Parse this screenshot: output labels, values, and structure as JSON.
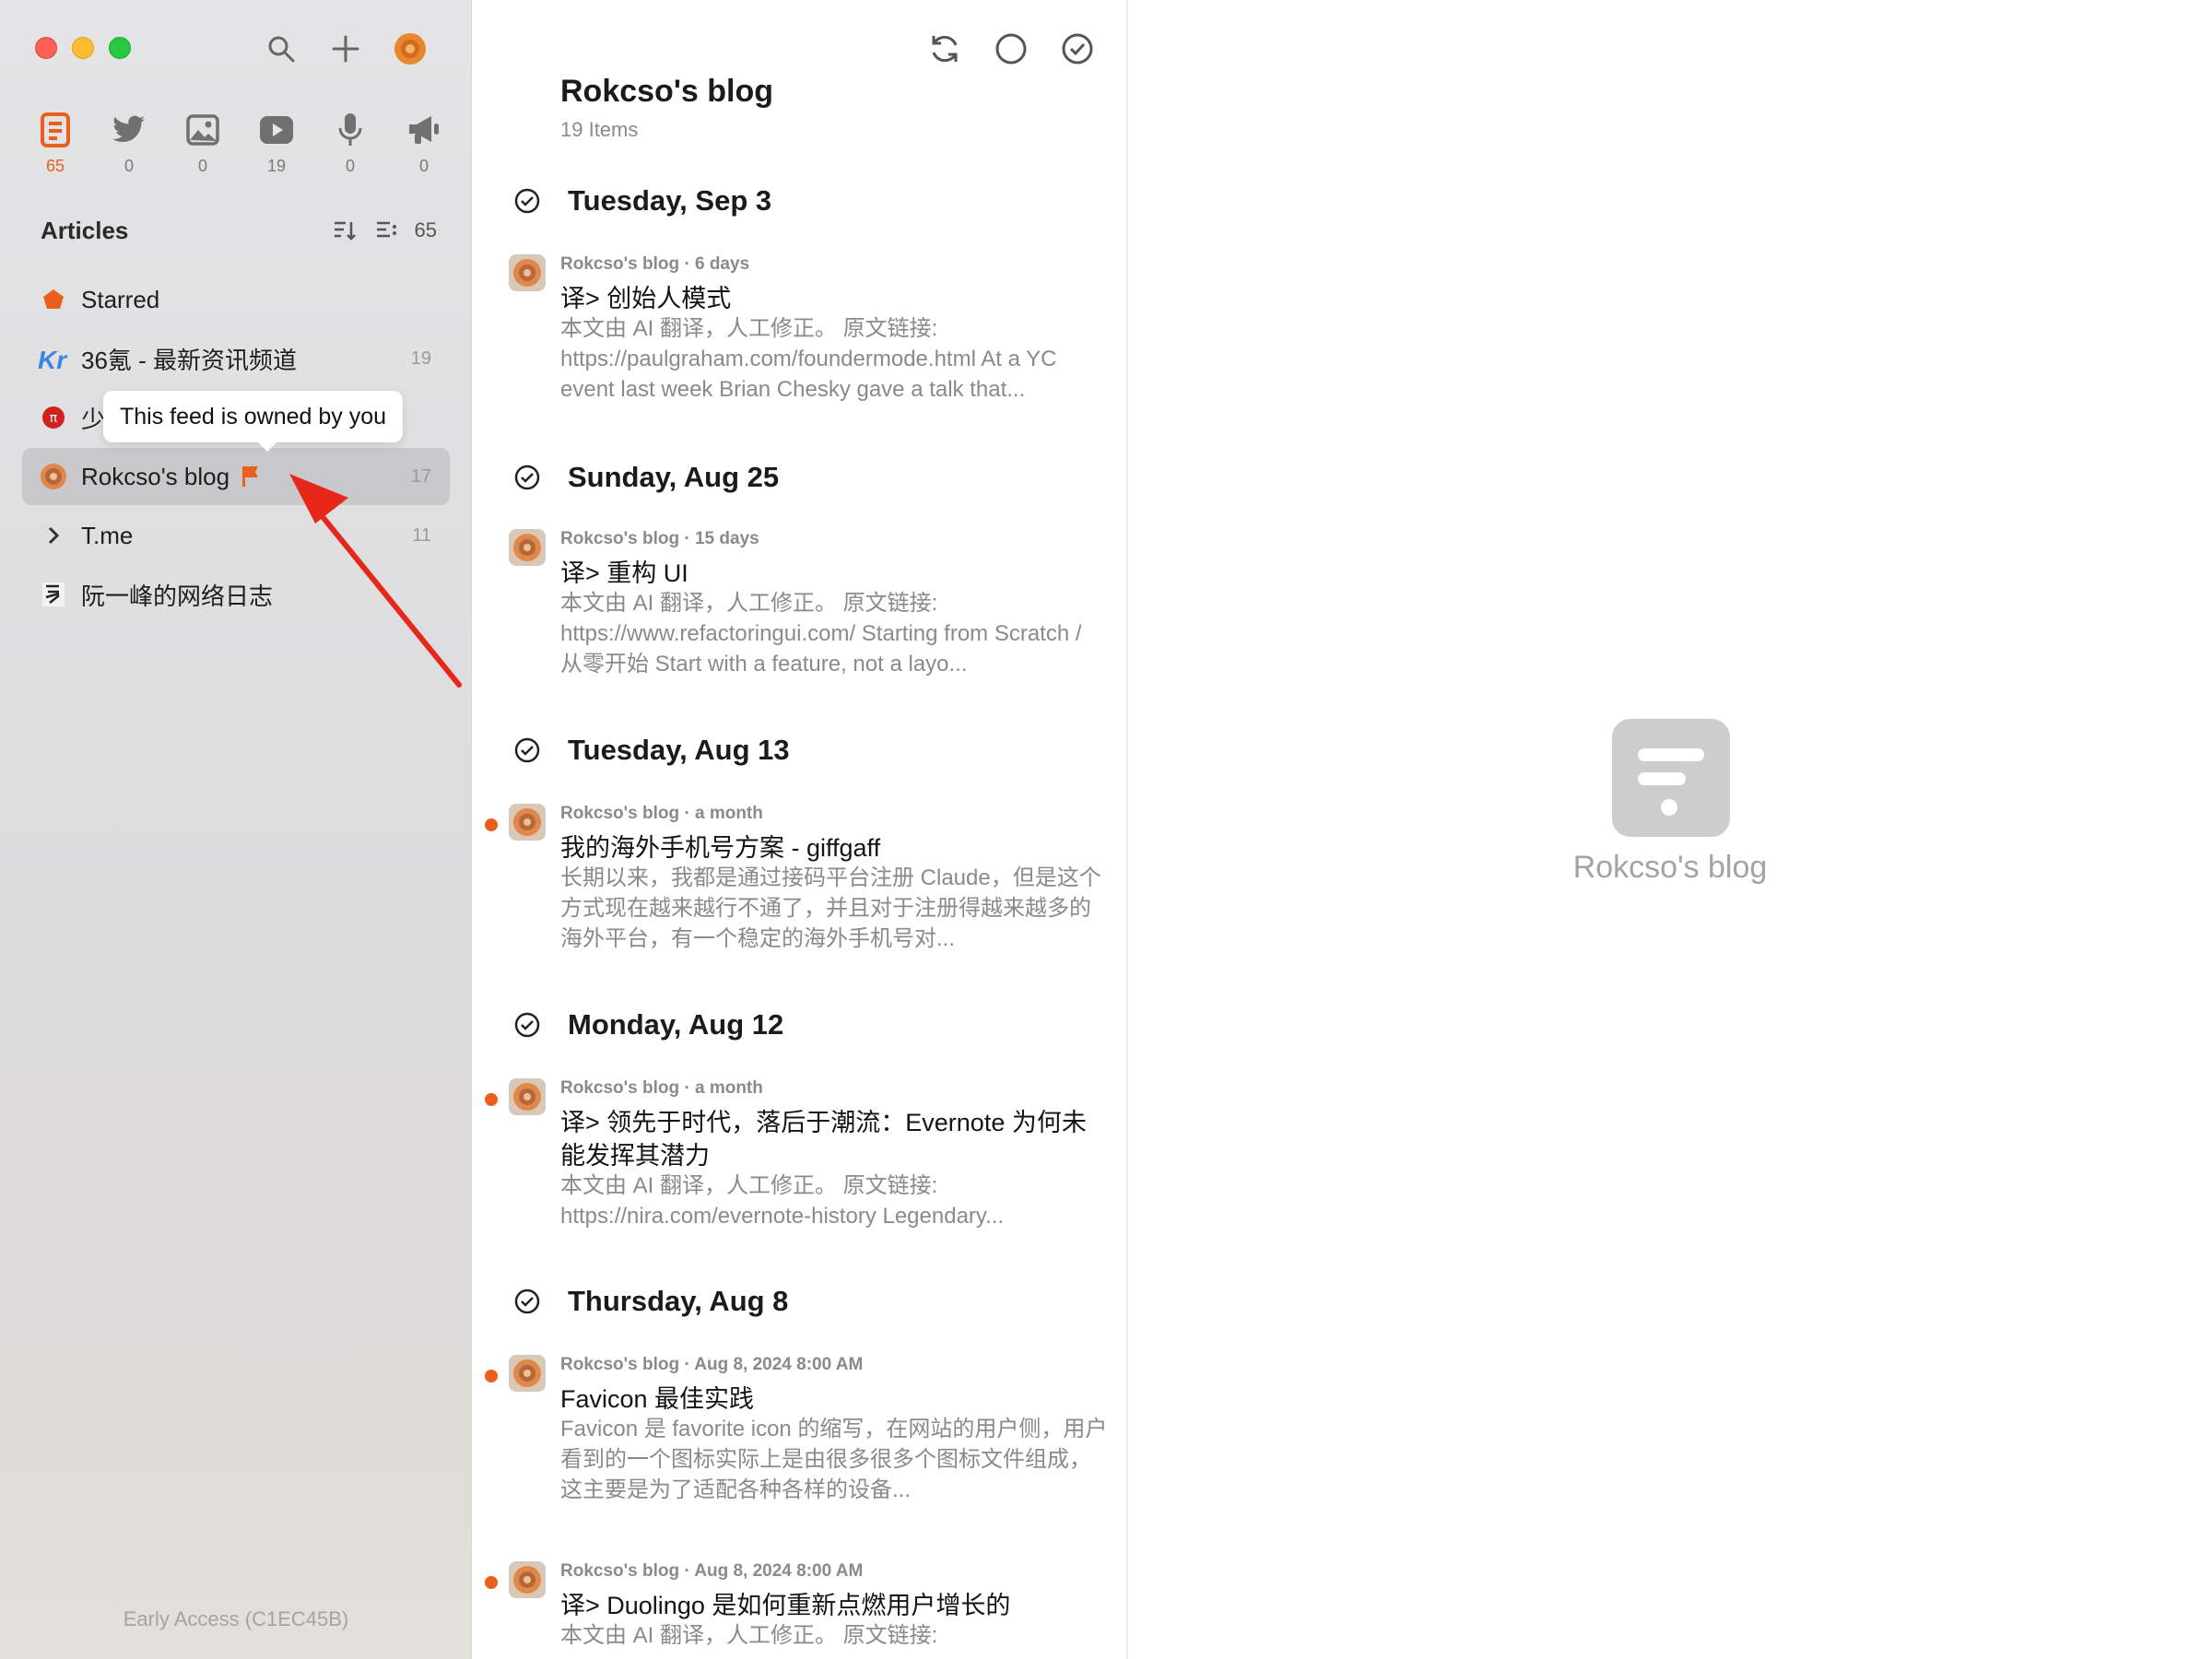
{
  "sidebar": {
    "views": [
      {
        "icon": "article-icon",
        "count": "65",
        "active": true
      },
      {
        "icon": "twitter-icon",
        "count": "0"
      },
      {
        "icon": "image-icon",
        "count": "0"
      },
      {
        "icon": "video-icon",
        "count": "19"
      },
      {
        "icon": "microphone-icon",
        "count": "0"
      },
      {
        "icon": "megaphone-icon",
        "count": "0"
      }
    ],
    "section_title": "Articles",
    "section_count": "65",
    "feeds": [
      {
        "name": "Starred",
        "count": ""
      },
      {
        "name": "36氪 - 最新资讯频道",
        "count": "19"
      },
      {
        "name": "少",
        "count": ""
      },
      {
        "name": "Rokcso's blog",
        "count": "17"
      },
      {
        "name": "T.me",
        "count": "11"
      },
      {
        "name": "阮一峰的网络日志",
        "count": ""
      }
    ],
    "tooltip": "This feed is owned by you",
    "footer": "Early Access (C1EC45B)"
  },
  "list": {
    "title": "Rokcso's blog",
    "subtitle": "19 Items",
    "days": [
      {
        "label": "Tuesday, Sep 3",
        "entries": [
          {
            "meta": "Rokcso's blog · 6 days",
            "title": "译> 创始人模式",
            "summary": "本文由 AI 翻译，人工修正。 原文链接: https://paulgraham.com/foundermode.html At a YC event last week Brian Chesky gave a talk that...",
            "unread": false
          }
        ]
      },
      {
        "label": "Sunday, Aug 25",
        "entries": [
          {
            "meta": "Rokcso's blog · 15 days",
            "title": "译> 重构 UI",
            "summary": "本文由 AI 翻译，人工修正。 原文链接: https://www.refactoringui.com/ Starting from Scratch / 从零开始 Start with a feature, not a layo...",
            "unread": false
          }
        ]
      },
      {
        "label": "Tuesday, Aug 13",
        "entries": [
          {
            "meta": "Rokcso's blog · a month",
            "title": "我的海外手机号方案 - giffgaff",
            "summary": "长期以来，我都是通过接码平台注册 Claude，但是这个方式现在越来越行不通了，并且对于注册得越来越多的海外平台，有一个稳定的海外手机号对...",
            "unread": true
          }
        ]
      },
      {
        "label": "Monday, Aug 12",
        "entries": [
          {
            "meta": "Rokcso's blog · a month",
            "title": "译> 领先于时代，落后于潮流：Evernote 为何未能发挥其潜力",
            "summary": "本文由 AI 翻译，人工修正。 原文链接: https://nira.com/evernote-history Legendary...",
            "unread": true
          }
        ]
      },
      {
        "label": "Thursday, Aug 8",
        "entries": [
          {
            "meta": "Rokcso's blog · Aug 8, 2024 8:00 AM",
            "title": "Favicon 最佳实践",
            "summary": "Favicon 是 favorite icon 的缩写，在网站的用户侧，用户看到的一个图标实际上是由很多很多个图标文件组成，这主要是为了适配各种各样的设备...",
            "unread": true
          },
          {
            "meta": "Rokcso's blog · Aug 8, 2024 8:00 AM",
            "title": "译> Duolingo 是如何重新点燃用户增长的",
            "summary": "本文由 AI 翻译，人工修正。 原文链接:",
            "unread": true
          }
        ]
      }
    ]
  },
  "reader": {
    "feed_name": "Rokcso's blog"
  },
  "colors": {
    "accent": "#e8601c",
    "sidebar_bg": "#dcdcdd",
    "selected_row": "#c9c9cb",
    "arrow": "#e8271b"
  }
}
